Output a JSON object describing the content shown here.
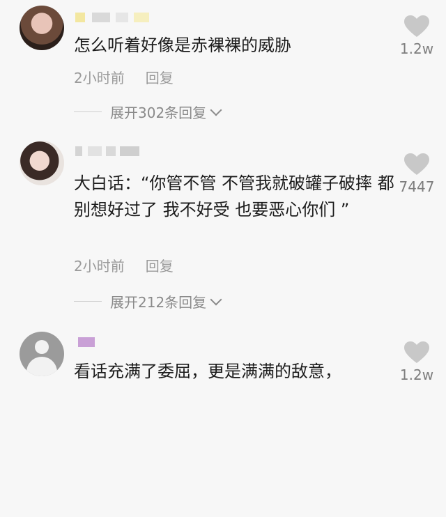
{
  "comments": [
    {
      "text": "怎么听着好像是赤裸裸的威胁",
      "time": "2小时前",
      "reply_label": "回复",
      "expand_label": "展开302条回复",
      "likes": "1.2w"
    },
    {
      "text": "大白话：“你管不管 不管我就破罐子破摔 都别想好过了 我不好受 也要恶心你们 ”",
      "time": "2小时前",
      "reply_label": "回复",
      "expand_label": "展开212条回复",
      "likes": "7447"
    },
    {
      "text": "看话充满了委屈，更是满满的敌意，",
      "likes": "1.2w"
    }
  ],
  "colors": {
    "background": "#f7f7f7",
    "text": "#1c1c1c",
    "meta": "#9a9a9a",
    "heart": "#c8c8c8",
    "username_accent": "#c9a0d6"
  },
  "icons": [
    "heart-icon",
    "chevron-down-icon",
    "default-avatar-icon"
  ]
}
